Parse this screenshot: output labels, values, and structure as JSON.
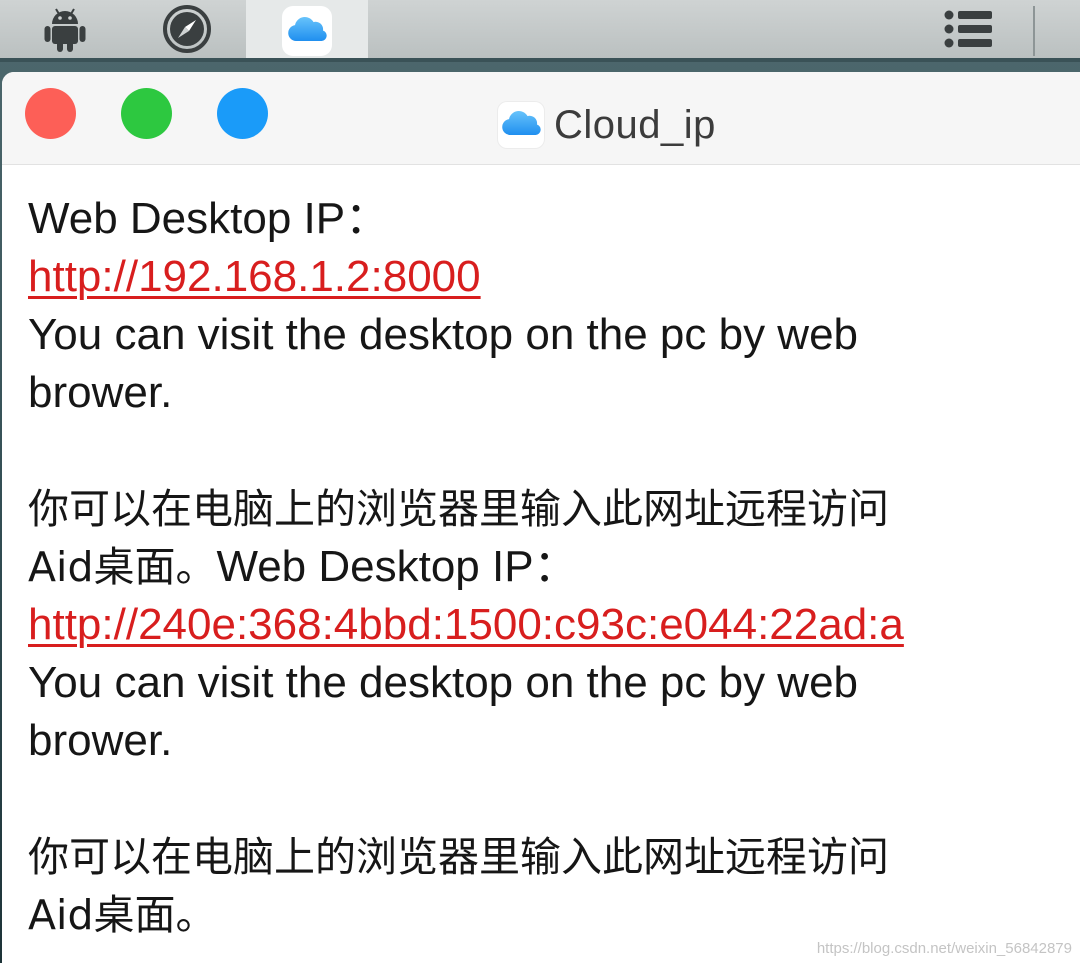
{
  "taskbar": {
    "items": [
      {
        "name": "android-icon"
      },
      {
        "name": "compass-icon"
      },
      {
        "name": "cloud-icon",
        "active": true
      },
      {
        "name": "list-menu-icon"
      }
    ]
  },
  "window": {
    "title": "Cloud_ip",
    "traffic_lights": {
      "close": "#fd5f57",
      "minimize": "#2dc840",
      "maximize": "#1a9bf9"
    }
  },
  "content": {
    "ipv4_label": "Web Desktop IP：",
    "ipv4_url": "http://192.168.1.2:8000",
    "ipv4_desc_line1": "You can visit the desktop on the pc by web",
    "ipv4_desc_line2": "brower.",
    "ipv4_cn_line1": "你可以在电脑上的浏览器里输入此网址远程访问",
    "ipv4_cn_line2_a": "Aid桌面。",
    "ipv6_label": "Web Desktop IP：",
    "ipv6_url": "http://240e:368:4bbd:1500:c93c:e044:22ad:a",
    "ipv6_desc_line1": "You can visit the desktop on the pc by web",
    "ipv6_desc_line2": "brower.",
    "ipv6_cn_line1": "你可以在电脑上的浏览器里输入此网址远程访问",
    "ipv6_cn_line2": "Aid桌面。"
  },
  "watermark": "https://blog.csdn.net/weixin_56842879",
  "colors": {
    "link": "#d81e1e",
    "text": "#161616",
    "cloud_icon": "#3ba6f5"
  }
}
